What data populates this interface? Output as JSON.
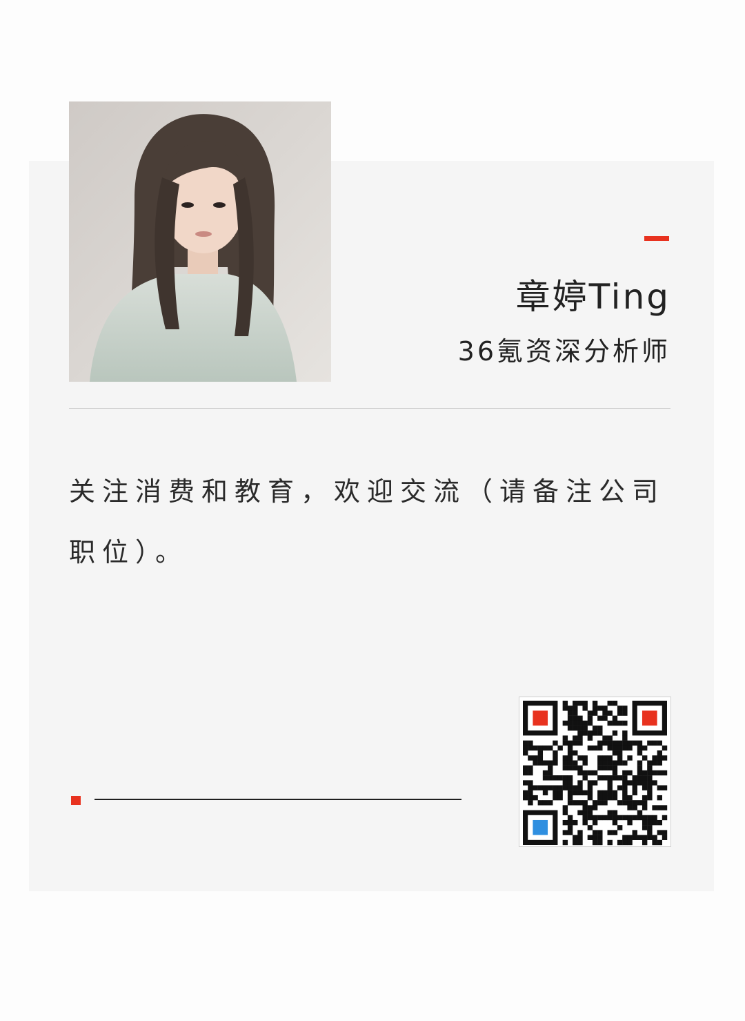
{
  "profile": {
    "name": "章婷Ting",
    "title": "36氪资深分析师",
    "bio": "关注消费和教育，欢迎交流（请备注公司职位）。"
  },
  "colors": {
    "accent": "#e8321f",
    "card_background": "#f5f5f5",
    "page_background": "#fdfdfd",
    "qr_finder_accent": "#e8321f",
    "qr_corner_blue": "#2f8fe0"
  },
  "icons": {
    "qr_code": "qr-code-icon"
  }
}
